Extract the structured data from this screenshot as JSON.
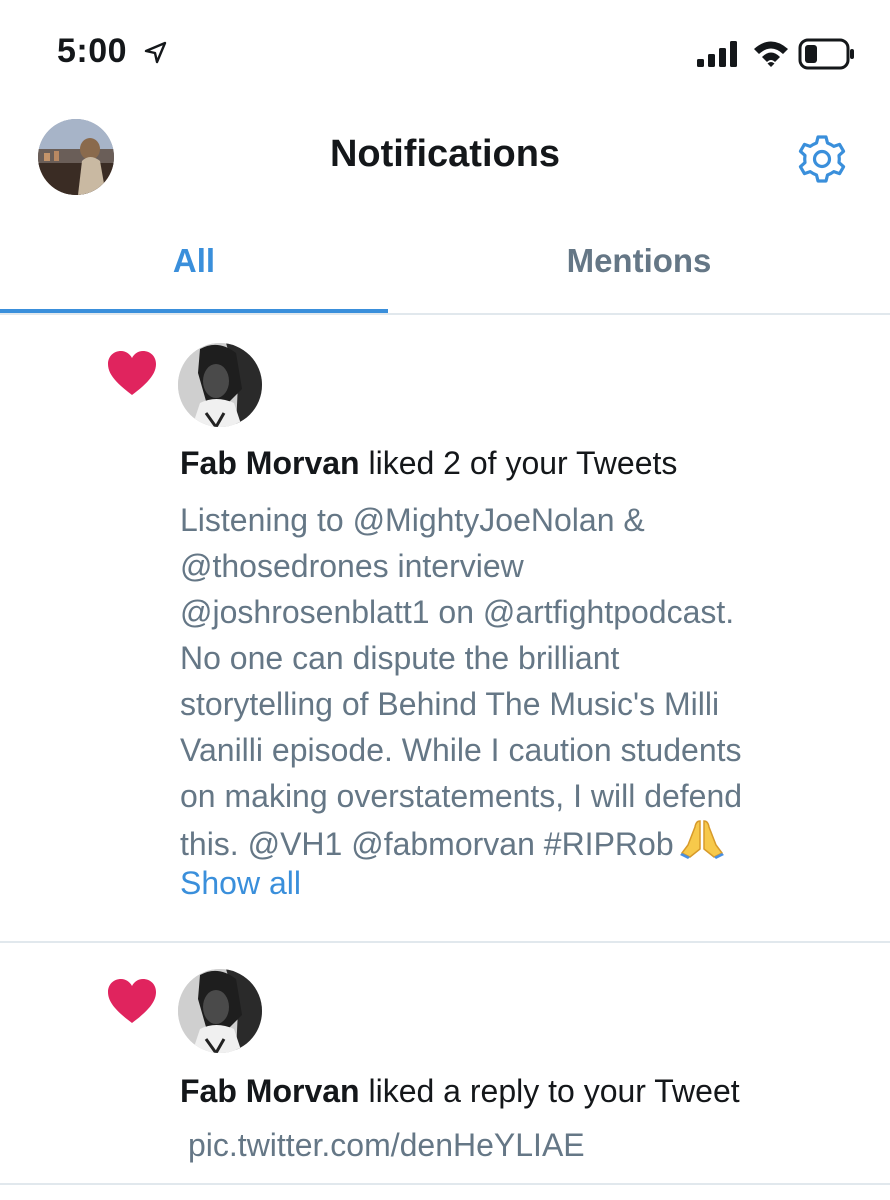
{
  "status_bar": {
    "time": "5:00",
    "icons": [
      "location-arrow-icon",
      "signal-icon",
      "wifi-icon",
      "battery-icon"
    ]
  },
  "header": {
    "title": "Notifications",
    "icons": [
      "avatar",
      "settings-gear-icon"
    ]
  },
  "tabs": [
    {
      "label": "All",
      "selected": true
    },
    {
      "label": "Mentions",
      "selected": false
    }
  ],
  "notifications": [
    {
      "icon": "heart-icon",
      "user": "Fab Morvan",
      "action": "liked 2 of your Tweets",
      "tweet_lines": [
        "Listening to @MightyJoeNolan &",
        "@thosedrones interview",
        "@joshrosenblatt1 on @artfightpodcast.",
        "No one can dispute the brilliant",
        "storytelling of Behind The Music's Milli",
        "Vanilli episode. While I caution students",
        "on making overstatements, I will defend",
        "this. @VH1 @fabmorvan #RIPRob"
      ],
      "emoji": "folded-hands-icon",
      "show_all": "Show all"
    },
    {
      "icon": "heart-icon",
      "user": "Fab Morvan",
      "action": "liked a reply to your Tweet",
      "link": "pic.twitter.com/denHeYLIAE"
    }
  ],
  "colors": {
    "accent": "#3a8fdb",
    "heart": "#e0245e",
    "secondary_text": "#657786",
    "divider": "#e1e8ed"
  }
}
